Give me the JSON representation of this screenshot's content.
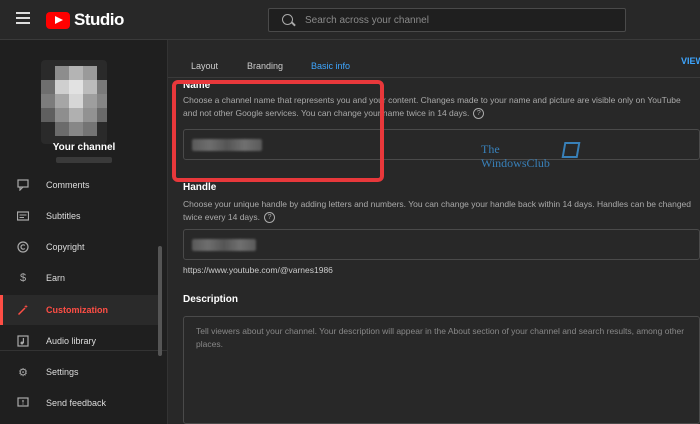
{
  "app": {
    "logo_text": "Studio"
  },
  "search": {
    "placeholder": "Search across your channel"
  },
  "sidebar": {
    "channel_label": "Your channel",
    "items": [
      {
        "label": "Comments",
        "icon": "comment-icon"
      },
      {
        "label": "Subtitles",
        "icon": "subtitles-icon"
      },
      {
        "label": "Copyright",
        "icon": "copyright-icon"
      },
      {
        "label": "Earn",
        "icon": "dollar-icon"
      },
      {
        "label": "Customization",
        "icon": "magic-wand-icon",
        "active": true
      },
      {
        "label": "Audio library",
        "icon": "audio-library-icon"
      },
      {
        "label": "Settings",
        "icon": "gear-icon"
      },
      {
        "label": "Send feedback",
        "icon": "feedback-icon"
      }
    ]
  },
  "tabs": [
    {
      "label": "Layout"
    },
    {
      "label": "Branding"
    },
    {
      "label": "Basic info",
      "active": true
    }
  ],
  "view_link": "VIEW",
  "name_section": {
    "title": "Name",
    "description": "Choose a channel name that represents you and your content. Changes made to your name and picture are visible only on YouTube and not other Google services. You can change your name twice in 14 days."
  },
  "handle_section": {
    "title": "Handle",
    "description": "Choose your unique handle by adding letters and numbers. You can change your handle back within 14 days. Handles can be changed twice every 14 days.",
    "url": "https://www.youtube.com/@varnes1986"
  },
  "description_section": {
    "title": "Description",
    "placeholder": "Tell viewers about your channel. Your description will appear in the About section of your channel and search results, among other places."
  },
  "watermark": {
    "line1": "The",
    "line2": "WindowsClub"
  },
  "colors": {
    "accent_red": "#ff4e45",
    "link_blue": "#3ea6ff",
    "highlight": "#e8383b"
  }
}
